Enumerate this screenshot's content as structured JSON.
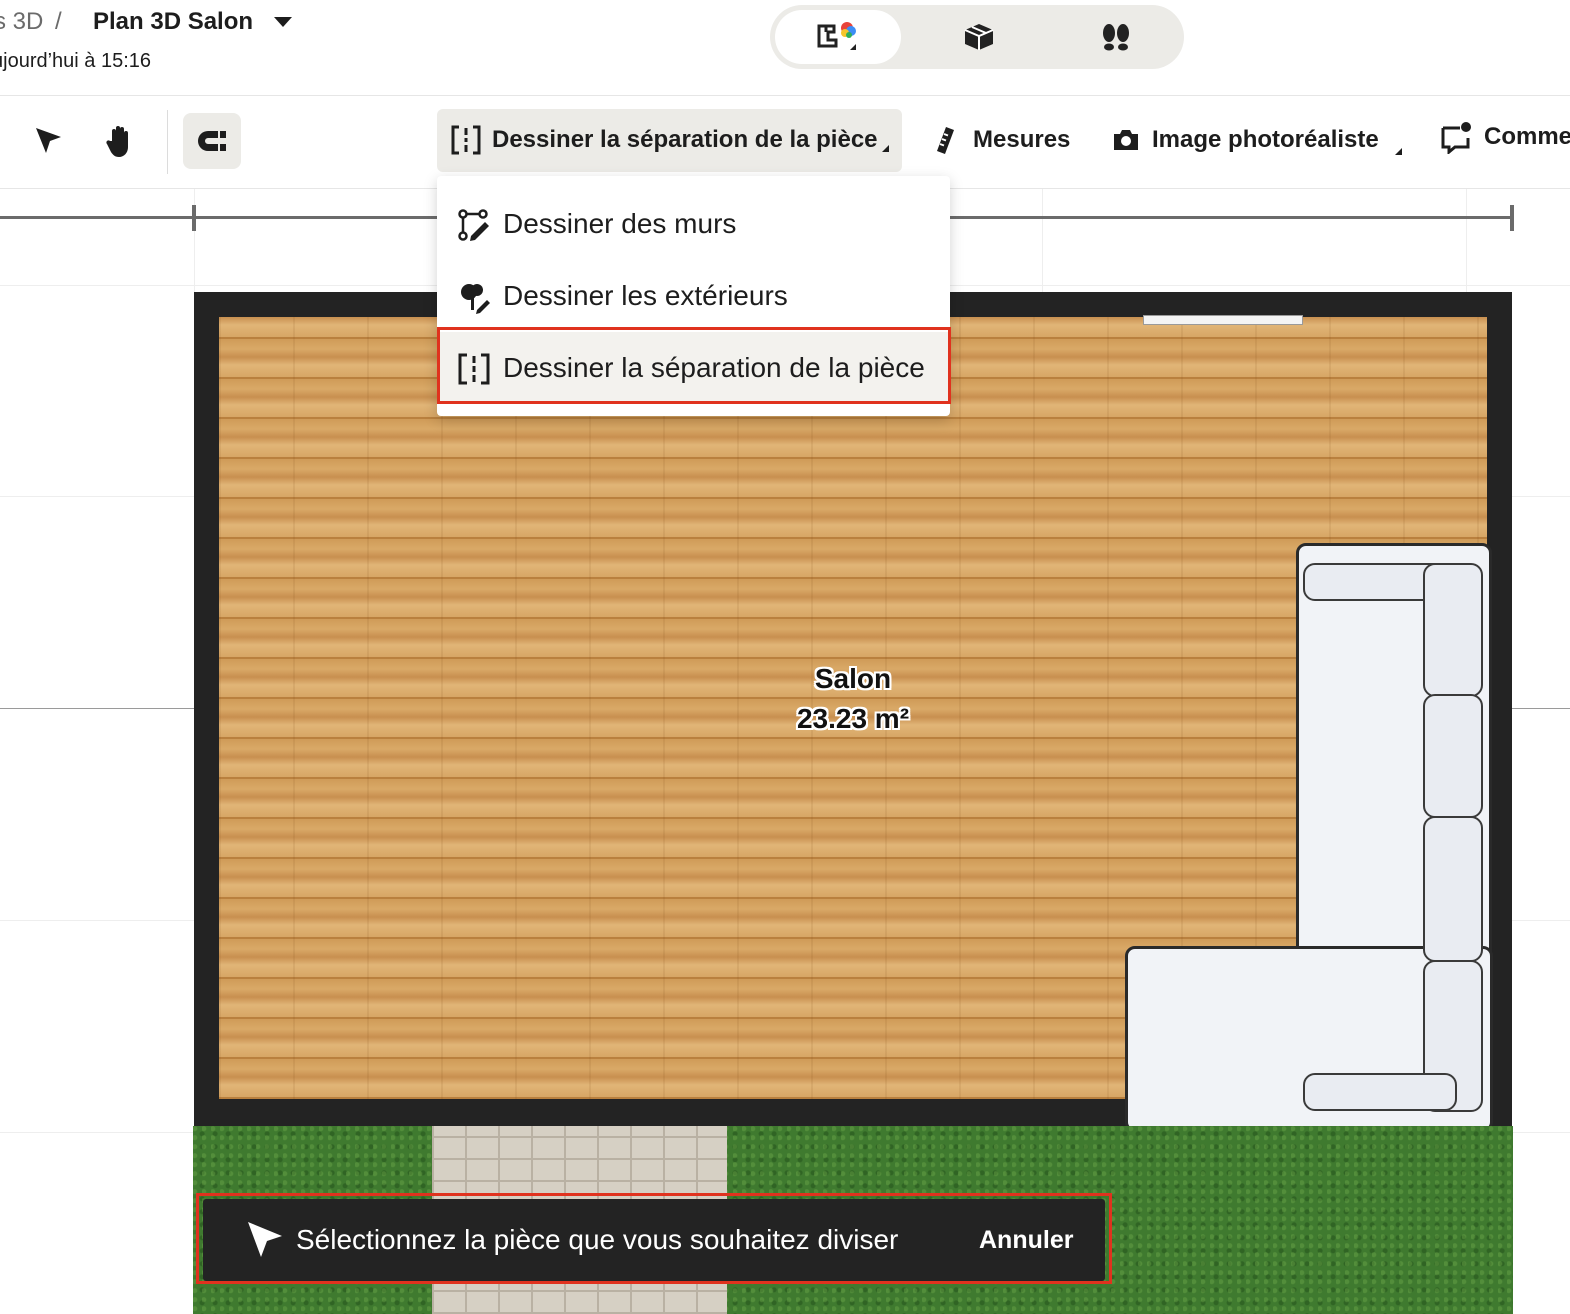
{
  "header": {
    "breadcrumb_prev": "s 3D",
    "breadcrumb_sep": "/",
    "title": "Plan 3D Salon",
    "saved_at": "ujourd’hui à 15:16"
  },
  "view_switcher": {
    "items": [
      {
        "icon": "plan-2d-3d-icon",
        "active": true
      },
      {
        "icon": "box-3d-icon",
        "active": false
      },
      {
        "icon": "footprints-icon",
        "active": false
      }
    ]
  },
  "toolbar": {
    "select_icon": "cursor-arrow-icon",
    "pan_icon": "hand-icon",
    "magnet_icon": "magnet-icon",
    "draw_label": "Dessiner la séparation de la pièce",
    "measures_label": "Mesures",
    "photo_label": "Image photoréaliste",
    "comments_label": "Comme"
  },
  "dropdown": {
    "items": [
      {
        "label": "Dessiner des murs",
        "icon": "wall-draw-icon"
      },
      {
        "label": "Dessiner les extérieurs",
        "icon": "tree-pencil-icon"
      },
      {
        "label": "Dessiner la séparation de la pièce",
        "icon": "room-split-icon"
      }
    ]
  },
  "room": {
    "name": "Salon",
    "area": "23.23 m²"
  },
  "toast": {
    "message": "Sélectionnez la pièce que vous souhaitez diviser",
    "cancel_label": "Annuler"
  },
  "colors": {
    "highlight_border": "#e0321e",
    "toast_bg": "#232323",
    "wall": "#232323",
    "floor": "#cf9a58",
    "grass": "#3f7a2f"
  }
}
